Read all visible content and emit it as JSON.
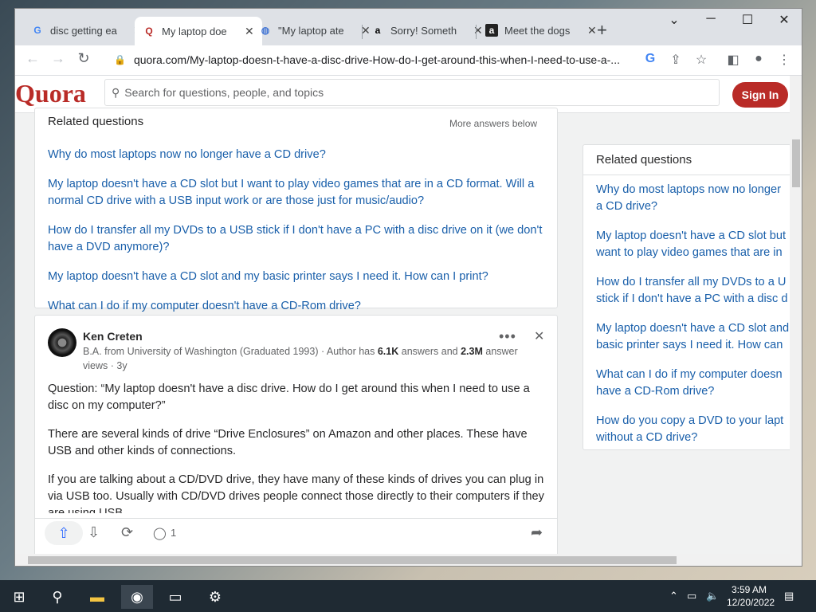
{
  "browser": {
    "tabs": [
      {
        "label": "disc getting ea",
        "favicon": "google-icon"
      },
      {
        "label": "My laptop doe",
        "favicon": "quora-icon"
      },
      {
        "label": "\"My laptop ate",
        "favicon": "globe-icon"
      },
      {
        "label": "Sorry! Someth",
        "favicon": "amazon-icon"
      },
      {
        "label": "Meet the dogs",
        "favicon": "amazon-a-icon"
      }
    ],
    "new_tab": "+",
    "url": "quora.com/My-laptop-doesn-t-have-a-disc-drive-How-do-I-get-around-this-when-I-need-to-use-a-..."
  },
  "header": {
    "logo": "Quora",
    "search_placeholder": "Search for questions, people, and topics",
    "signin": "Sign In"
  },
  "related_main": {
    "title": "Related questions",
    "more": "More answers below",
    "items": [
      "Why do most laptops now no longer have a CD drive?",
      "My laptop doesn't have a CD slot but I want to play video games that are in a CD format. Will a normal CD drive with a USB input work or are those just for music/audio?",
      "How do I transfer all my DVDs to a USB stick if I don't have a PC with a disc drive on it (we don't have a DVD anymore)?",
      "My laptop doesn't have a CD slot and my basic printer says I need it. How can I print?",
      "What can I do if my computer doesn't have a CD-Rom drive?"
    ]
  },
  "answer": {
    "author": "Ken Creten",
    "cred_prefix": "B.A. from University of Washington (Graduated 1993) · Author has ",
    "answers_count": "6.1K",
    "cred_mid": " answers and ",
    "views_count": "2.3M",
    "cred_suffix": " answer views · 3y",
    "paragraphs": [
      "Question: “My laptop doesn't have a disc drive. How do I get around this when I need to use a disc on my computer?”",
      "There are several kinds of drive “Drive Enclosures” on Amazon and other places. These have USB and other kinds of connections.",
      "If you are talking about a CD/DVD drive, they have many of these kinds of drives you can plug in via USB too. Usually with CD/DVD drives people connect those directly to their computers if they are using USB."
    ],
    "comments": "1"
  },
  "related_side": {
    "title": "Related questions",
    "items": [
      [
        "Why do most laptops now no longer",
        "a CD drive?"
      ],
      [
        "My laptop doesn't have a CD slot but",
        "want to play video games that are in"
      ],
      [
        "How do I transfer all my DVDs to a U",
        "stick if I don't have a PC with a disc d"
      ],
      [
        "My laptop doesn't have a CD slot and",
        "basic printer says I need it. How can"
      ],
      [
        "What can I do if my computer doesn",
        "have a CD-Rom drive?"
      ],
      [
        "How do you copy a DVD to your lapt",
        "without a CD drive?"
      ]
    ]
  },
  "taskbar": {
    "time": "3:59 AM",
    "date": "12/20/2022"
  },
  "colors": {
    "quora_red": "#b92b27",
    "link_blue": "#195faa"
  }
}
